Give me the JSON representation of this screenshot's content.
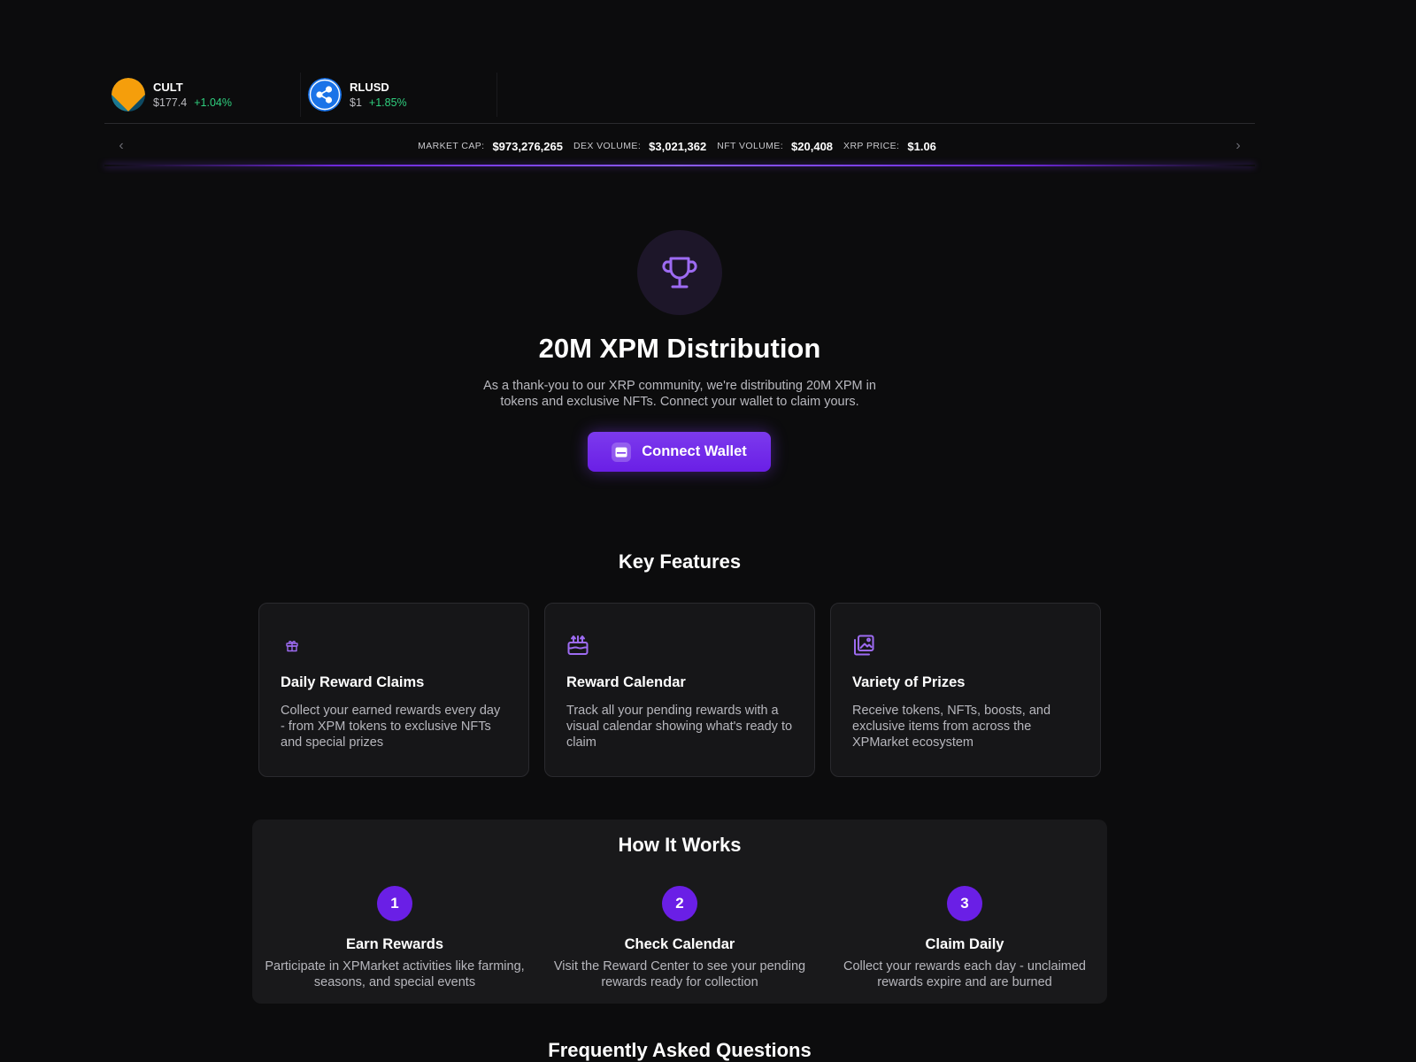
{
  "ticker": {
    "tokens": [
      {
        "symbol": "CULT",
        "price": "$177.4",
        "change": "+1.04%",
        "logo_icon": "cult-logo-icon"
      },
      {
        "symbol": "RLUSD",
        "price": "$1",
        "change": "+1.85%",
        "logo_icon": "ripple-logo-icon"
      }
    ],
    "stats": [
      {
        "label": "MARKET CAP:",
        "value": "$973,276,265"
      },
      {
        "label": "DEX VOLUME:",
        "value": "$3,021,362"
      },
      {
        "label": "NFT VOLUME:",
        "value": "$20,408"
      },
      {
        "label": "XRP PRICE:",
        "value": "$1.06"
      }
    ],
    "prev_icon": "chevron-left-icon",
    "next_icon": "chevron-right-icon"
  },
  "hero": {
    "icon": "trophy-icon",
    "title": "20M XPM Distribution",
    "description": "As a thank-you to our XRP community, we're distributing 20M XPM in tokens and exclusive NFTs. Connect your wallet to claim yours.",
    "button_label": "Connect Wallet",
    "button_icon": "wallet-icon"
  },
  "features": {
    "title": "Key Features",
    "items": [
      {
        "icon": "gift-icon",
        "title": "Daily Reward Claims",
        "description": "Collect your earned rewards every day - from XPM tokens to exclusive NFTs and special prizes"
      },
      {
        "icon": "cake-icon",
        "title": "Reward Calendar",
        "description": "Track all your pending rewards with a visual calendar showing what's ready to claim"
      },
      {
        "icon": "gallery-icon",
        "title": "Variety of Prizes",
        "description": "Receive tokens, NFTs, boosts, and exclusive items from across the XPMarket ecosystem"
      }
    ]
  },
  "how_it_works": {
    "title": "How It Works",
    "steps": [
      {
        "number": "1",
        "title": "Earn Rewards",
        "description": "Participate in XPMarket activities like farming, seasons, and special events"
      },
      {
        "number": "2",
        "title": "Check Calendar",
        "description": "Visit the Reward Center to see your pending rewards ready for collection"
      },
      {
        "number": "3",
        "title": "Claim Daily",
        "description": "Collect your rewards each day - unclaimed rewards expire and are burned"
      }
    ]
  },
  "faq": {
    "title": "Frequently Asked Questions"
  },
  "colors": {
    "accent": "#6a1fe6",
    "positive": "#2fcf7e",
    "background": "#0c0c0d",
    "card": "#161618"
  }
}
